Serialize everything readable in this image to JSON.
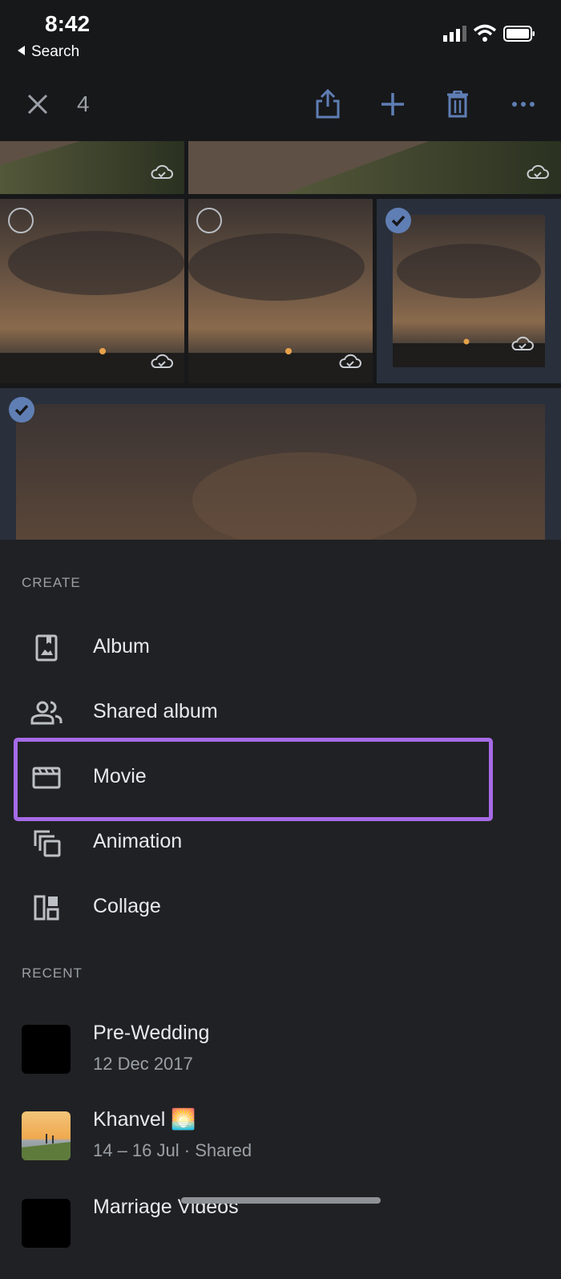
{
  "status_bar": {
    "time": "8:42",
    "back_label": "Search"
  },
  "toolbar": {
    "selected_count": "4"
  },
  "create": {
    "section_title": "CREATE",
    "items": [
      {
        "label": "Album",
        "icon": "album-icon"
      },
      {
        "label": "Shared album",
        "icon": "shared-album-icon"
      },
      {
        "label": "Movie",
        "icon": "movie-icon"
      },
      {
        "label": "Animation",
        "icon": "animation-icon"
      },
      {
        "label": "Collage",
        "icon": "collage-icon"
      }
    ]
  },
  "recent": {
    "section_title": "RECENT",
    "items": [
      {
        "title": "Pre-Wedding",
        "subtitle": "12 Dec 2017"
      },
      {
        "title": "Khanvel 🌅",
        "subtitle": "14 – 16 Jul  ·  Shared"
      },
      {
        "title": "Marriage Videos",
        "subtitle": ""
      }
    ]
  },
  "colors": {
    "highlight": "#a66be6",
    "selected_check": "#5f7eb4",
    "background": "#202124"
  }
}
